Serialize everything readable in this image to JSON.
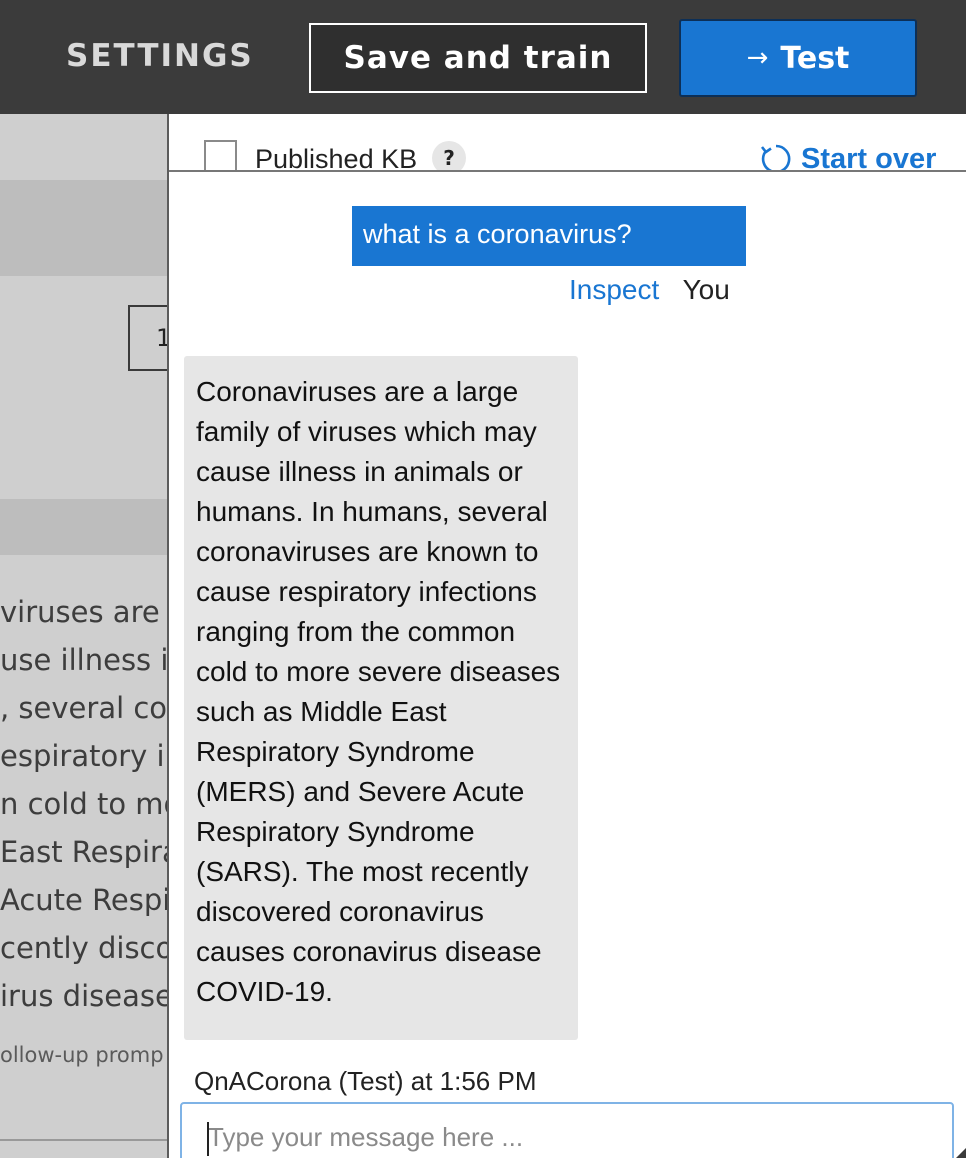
{
  "topbar": {
    "settings_label": "SETTINGS",
    "save_label": "Save and train",
    "test_label": "Test",
    "test_icon": "arrow-right-icon"
  },
  "background": {
    "page_number": "1",
    "text_lines": [
      "viruses are a",
      "use illness in",
      ", several cor",
      "espiratory inf",
      "n cold to mo",
      "East Respirat",
      "Acute Respira",
      "cently discov",
      "irus disease"
    ],
    "follow_up": "ollow-up promp"
  },
  "panel": {
    "published_label": "Published KB",
    "help_label": "?",
    "start_over_label": "Start over",
    "start_over_icon": "refresh-icon",
    "user_message": "what is a coronavirus?",
    "inspect_label": "Inspect",
    "you_label": "You",
    "bot_message": "Coronaviruses are a large family of viruses which may cause illness in animals or humans. In humans, several coronaviruses are known to cause respiratory infections ranging from the common cold to more severe diseases such as Middle East Respiratory Syndrome (MERS) and Severe Acute Respiratory Syndrome (SARS). The most recently discovered coronavirus causes coronavirus disease COVID-19.",
    "bot_meta": "QnACorona (Test) at 1:56 PM",
    "input_placeholder": "Type your message here ..."
  },
  "colors": {
    "topbar_bg": "#3b3b3b",
    "accent": "#1976d2",
    "bot_bubble": "#e6e6e6"
  }
}
